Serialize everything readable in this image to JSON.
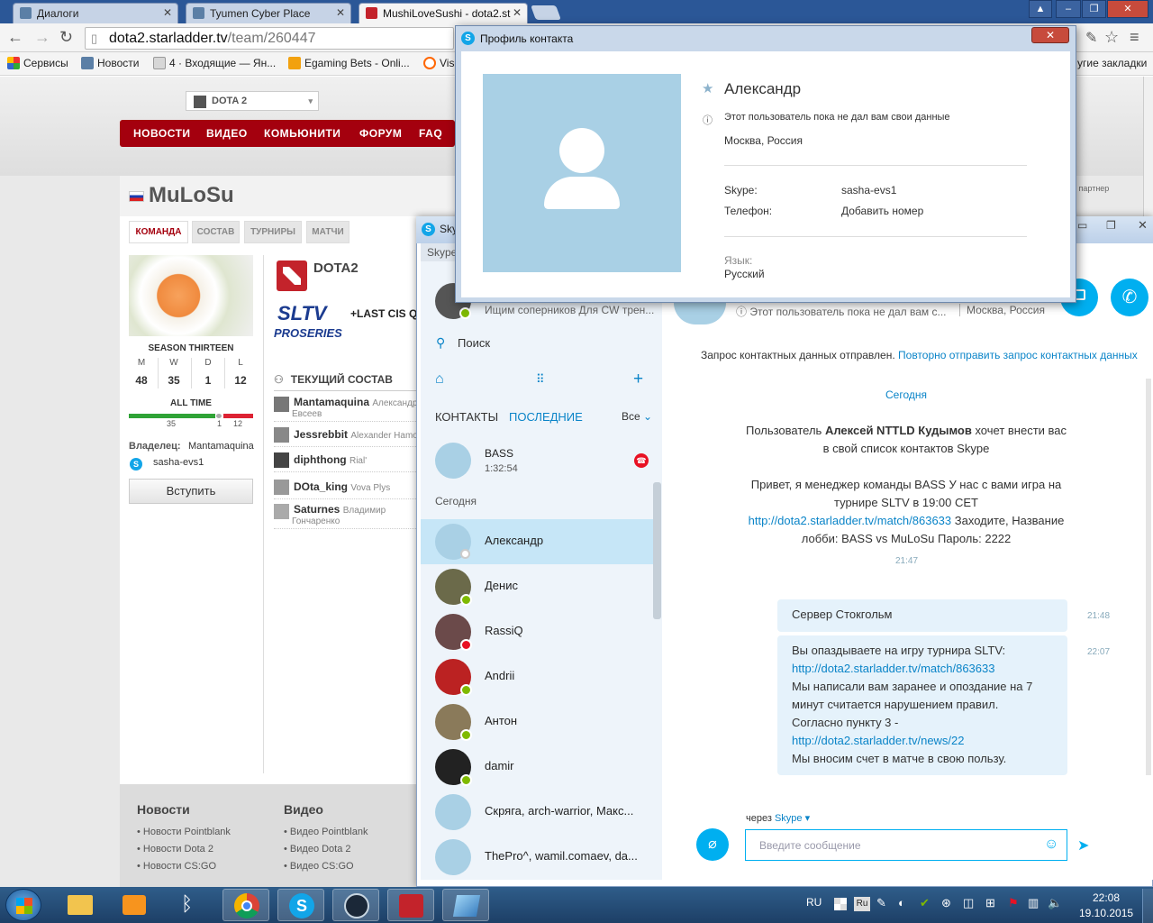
{
  "browser": {
    "tabs": [
      {
        "label": "Диалоги"
      },
      {
        "label": "Tyumen Cyber Place"
      },
      {
        "label": "MushiLoveSushi - dota2.st"
      }
    ],
    "url_host": "dota2.starladder.tv",
    "url_path": "/team/260447",
    "bookmarks": [
      {
        "label": "Сервисы"
      },
      {
        "label": "Новости"
      },
      {
        "label": "4 · Входящие — Ян..."
      },
      {
        "label": "Egaming Bets - Onli..."
      },
      {
        "label": "Vis"
      }
    ],
    "bookmarks_other": "угие закладки"
  },
  "site": {
    "game_select": "DOTA 2",
    "nav": [
      "НОВОСТИ",
      "ВИДЕО",
      "КОМЬЮНИТИ",
      "ФОРУМ",
      "FAQ"
    ],
    "team_name": "MuLoSu",
    "tabs": [
      "КОМАНДА",
      "СОСТАВ",
      "ТУРНИРЫ",
      "МАТЧИ"
    ],
    "season": "SEASON THIRTEEN",
    "stats": [
      {
        "label": "M",
        "value": "48"
      },
      {
        "label": "W",
        "value": "35"
      },
      {
        "label": "D",
        "value": "1"
      },
      {
        "label": "L",
        "value": "12"
      }
    ],
    "alltime": "ALL TIME",
    "alltime_values": [
      "35",
      "1",
      "12"
    ],
    "owner_label": "Владелец:",
    "owner_name": "Mantamaquina",
    "owner_skype": "sasha-evs1",
    "join_label": "Вступить",
    "game_title": "DOTA2",
    "sltv": "SLTV",
    "proseries": "PROSERIES",
    "last_cis": "+LAST CIS Q",
    "roster_title": "ТЕКУЩИЙ СОСТАВ",
    "roster": [
      {
        "nick": "Mantamaquina",
        "name": "Александр",
        "name2": "Евсеев"
      },
      {
        "nick": "Jessrebbit",
        "name": "Alexander Hamo",
        "name2": ""
      },
      {
        "nick": "diphthong",
        "name": "Rial'",
        "name2": ""
      },
      {
        "nick": "DOta_king",
        "name": "Vova Plys",
        "name2": ""
      },
      {
        "nick": "Saturnes",
        "name": "Владимир",
        "name2": "Гончаренко"
      }
    ],
    "partner": "й партнер",
    "footer": {
      "news_title": "Новости",
      "news": [
        "Новости Pointblank",
        "Новости Dota 2",
        "Новости CS:GO"
      ],
      "video_title": "Видео",
      "video": [
        "Видео Pointblank",
        "Видео Dota 2",
        "Видео CS:GO"
      ]
    }
  },
  "skype": {
    "title": "Skype",
    "menu_peek": "Skype",
    "profile_status": "Ищим соперников Для CW трен...",
    "search": "Поиск",
    "tab_contacts": "КОНТАКТЫ",
    "tab_recent": "ПОСЛЕДНИЕ",
    "filter": "Все",
    "bass_name": "BASS",
    "bass_time": "1:32:54",
    "today": "Сегодня",
    "contacts": [
      {
        "name": "Александр",
        "status": "unknown"
      },
      {
        "name": "Денис",
        "status": "online"
      },
      {
        "name": "RassiQ",
        "status": "dnd"
      },
      {
        "name": "Andrii",
        "status": "online"
      },
      {
        "name": "Антон",
        "status": "online"
      },
      {
        "name": "damir",
        "status": "online"
      },
      {
        "name": "Скряга, arch-warrior, Макс...",
        "status": "group"
      },
      {
        "name": "ThePro^, wamil.comaev, da...",
        "status": "group"
      }
    ],
    "chat_header_status": "Этот пользователь пока не дал вам с...",
    "chat_header_loc": "Москва, Россия",
    "request_sent": "Запрос контактных данных отправлен.",
    "resend": "Повторно отправить запрос контактных данных",
    "day": "Сегодня",
    "incoming": {
      "line1_pre": "Пользователь ",
      "line1_bold": "Алексей NTTLD Кудымов",
      "line1_post": " хочет внести вас",
      "line2": "в свой список контактов Skype",
      "line3": "Привет, я менеджер команды BASS У нас с вами игра на",
      "line4": "турнире SLTV в 19:00 CET",
      "line5_link": "http://dota2.starladder.tv/match/863633",
      "line5_post": " Заходите, Название",
      "line6": "лобби: BASS vs MuLoSu  Пароль: 2222",
      "time": "21:47"
    },
    "out1": {
      "text": "Сервер Стокгольм",
      "time": "21:48"
    },
    "out2": {
      "l1": "Вы опаздываете на игру турнира SLTV:",
      "l2": "http://dota2.starladder.tv/match/863633",
      "l3": "Мы написали вам заранее и опоздание на 7",
      "l4": "минут считается нарушением правил.",
      "l5": "Согласно пункту 3 -",
      "l6": "http://dota2.starladder.tv/news/22",
      "l7": "Мы вносим счет в матче в свою пользу.",
      "time": "22:07"
    },
    "via": "через",
    "via_skype": "Skype",
    "input_placeholder": "Введите сообщение"
  },
  "profile": {
    "title": "Профиль контакта",
    "name": "Александр",
    "notice": "Этот пользователь пока не дал вам свои данные",
    "location": "Москва, Россия",
    "skype_label": "Skype:",
    "skype_value": "sasha-evs1",
    "phone_label": "Телефон:",
    "phone_value": "Добавить номер",
    "lang_label": "Язык:",
    "lang_value": "Русский"
  },
  "taskbar": {
    "lang": "RU",
    "time": "22:08",
    "date": "19.10.2015",
    "ime": "Ru"
  }
}
